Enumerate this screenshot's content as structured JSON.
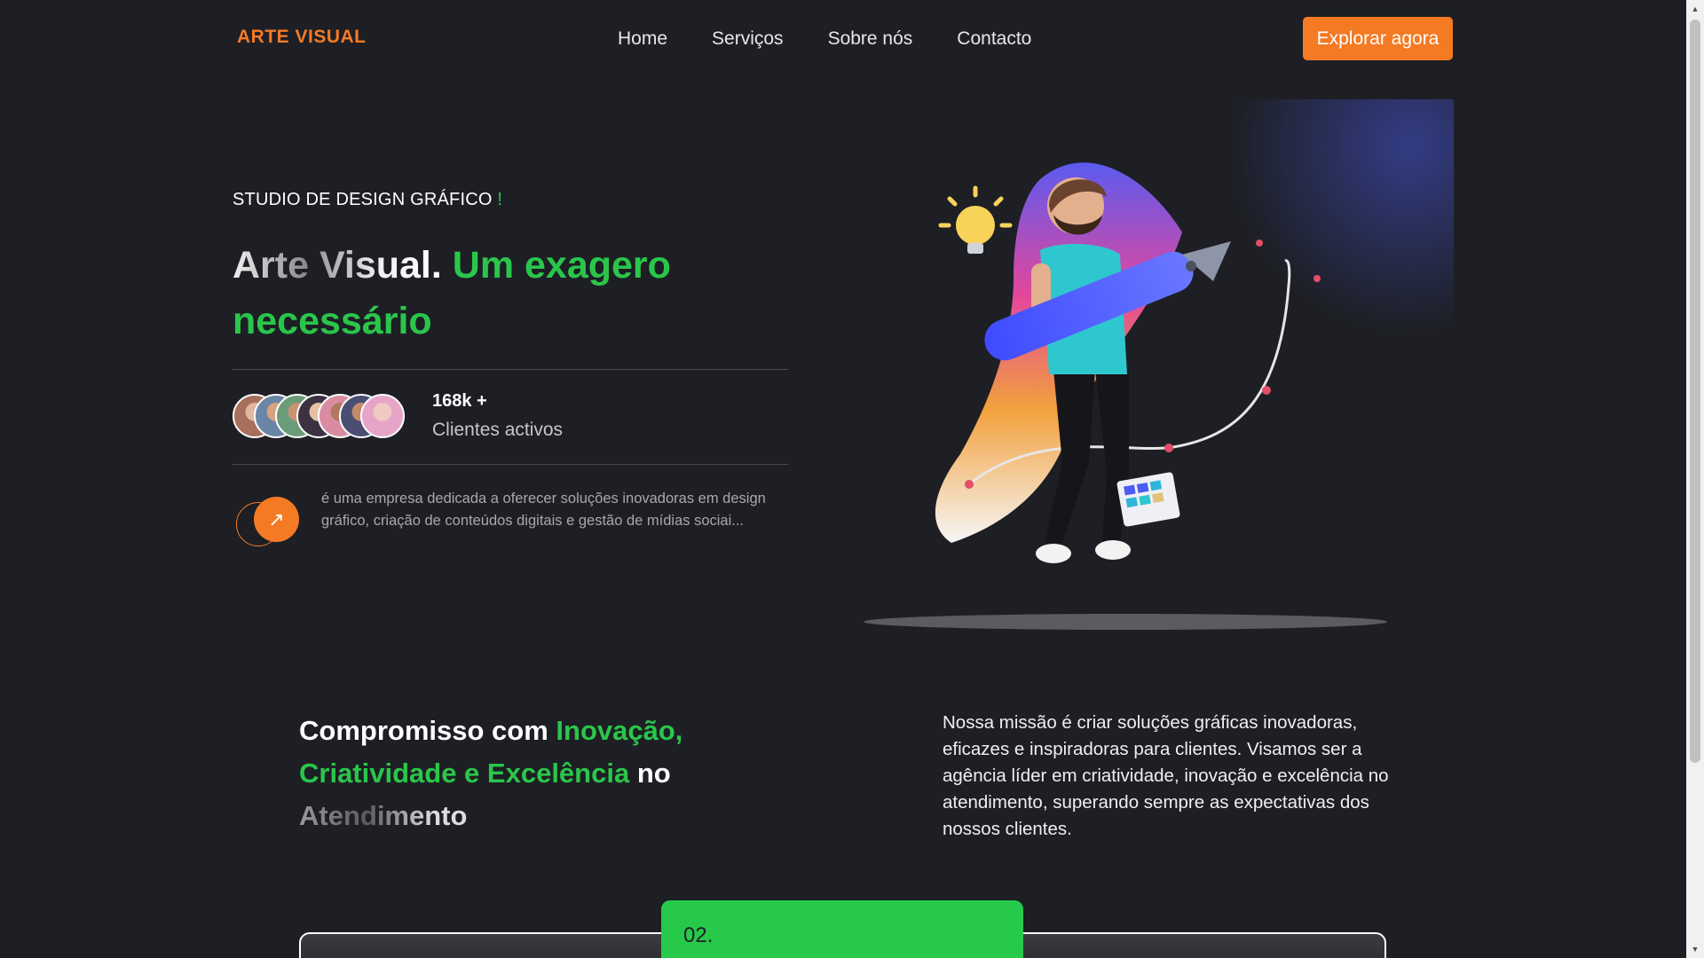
{
  "header": {
    "brand": "ARTE VISUAL",
    "nav": [
      "Home",
      "Serviços",
      "Sobre nós",
      "Contacto"
    ],
    "cta_label": "Explorar agora"
  },
  "hero": {
    "eyebrow": "STUDIO DE DESIGN GRÁFICO",
    "eyebrow_mark": "!",
    "headline_grad": "Arte Visual.",
    "headline_green": "Um exagero necessário",
    "stat_number": "168k +",
    "stat_label": "Clientes activos",
    "description": "é uma empresa dedicada a oferecer soluções inovadoras em design gráfico, criação de conteúdos digitais e gestão de mídias sociai...",
    "arrow_icon": "arrow-up-right-icon",
    "avatar_colors": [
      "#a86f5c",
      "#6a86a6",
      "#6b9c7a",
      "#3b3140",
      "#d98ba2",
      "#4a4e72",
      "#e6a5c8"
    ]
  },
  "mission": {
    "title_white": "Compromisso com",
    "title_green": "Inovação, Criatividade e Excelência",
    "title_white2": "no",
    "title_fade": "Atendimento",
    "text": "Nossa missão é criar soluções gráficas inovadoras, eficazes e inspiradoras para clientes. Visamos ser a agência líder em criatividade, inovação e excelência no atendimento, superando sempre as expectativas dos nossos clientes."
  },
  "cards": {
    "active_number": "02."
  },
  "colors": {
    "background": "#1d1f24",
    "accent_orange": "#f47a24",
    "accent_green": "#2ac64b"
  }
}
